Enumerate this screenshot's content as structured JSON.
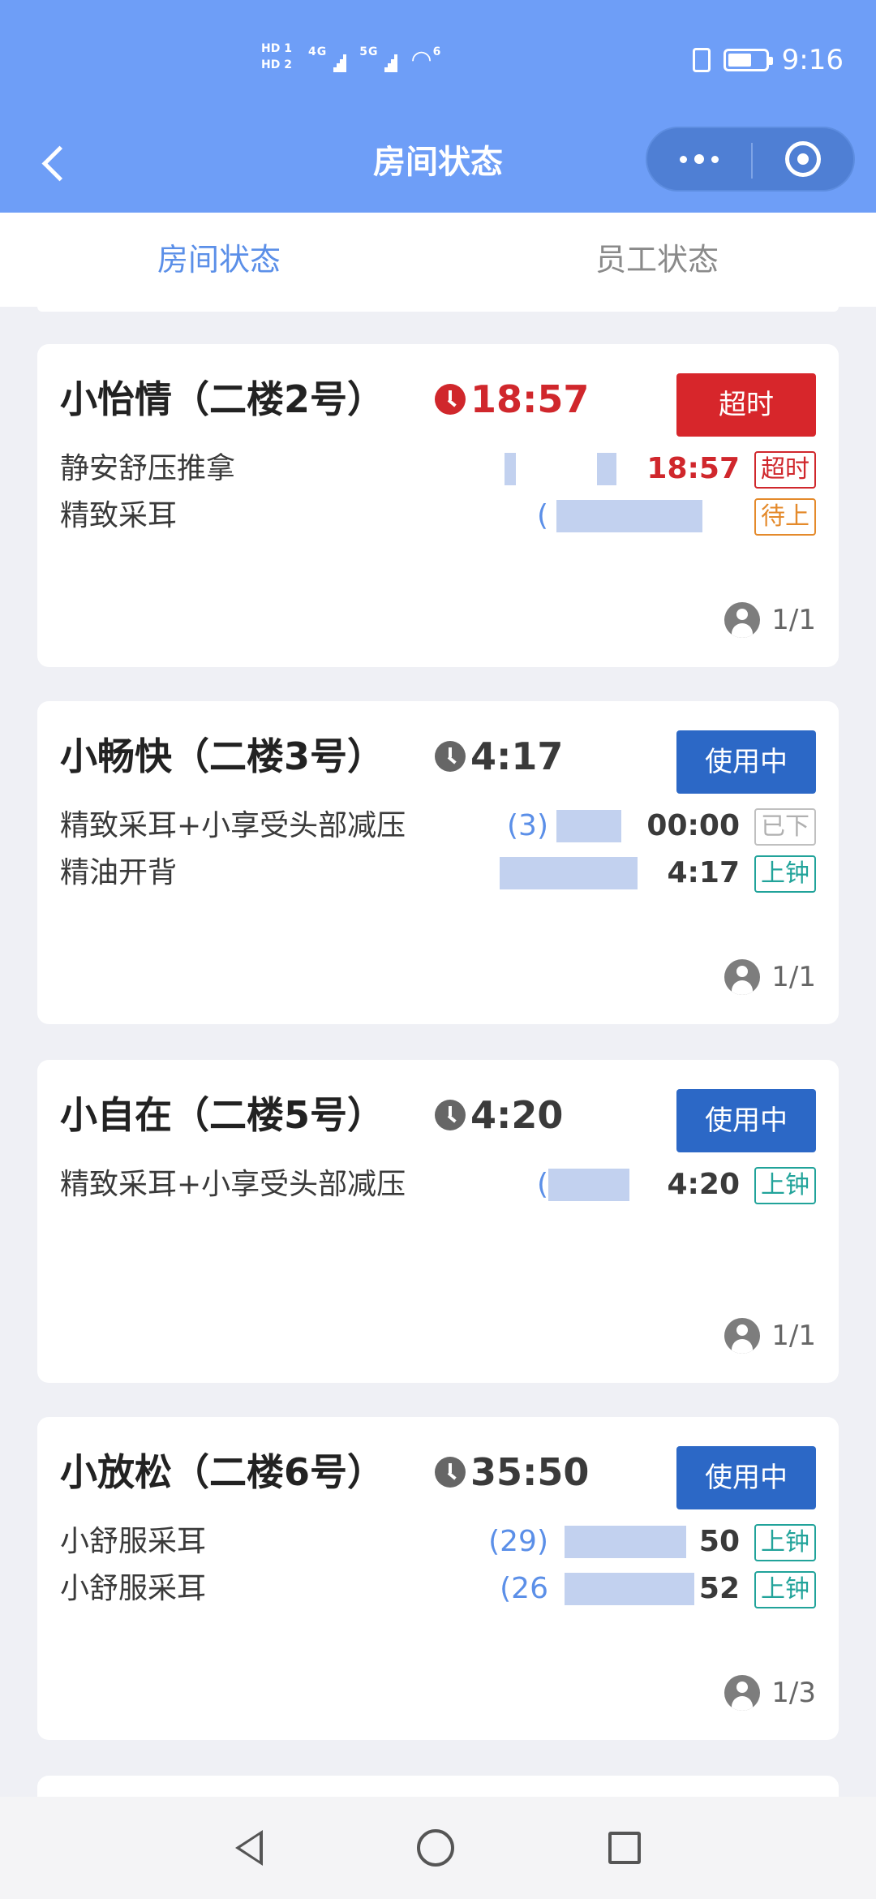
{
  "status_bar": {
    "sim1": "HD 1",
    "sim2": "HD 2",
    "net1": "4G",
    "net2": "5G",
    "wifi_label": "6",
    "time": "9:16"
  },
  "nav": {
    "title": "房间状态"
  },
  "tabs": [
    {
      "label": "房间状态",
      "active": true
    },
    {
      "label": "员工状态",
      "active": false
    }
  ],
  "rooms": [
    {
      "name": "小怡情（二楼2号）",
      "timer": "18:57",
      "timer_state": "overtime",
      "status": "超时",
      "services": [
        {
          "name": "静安舒压推拿",
          "staff": "",
          "time": "18:57",
          "badge": "超时"
        },
        {
          "name": "精致采耳",
          "staff": "(",
          "time": "",
          "badge": "待上"
        }
      ],
      "occupancy": "1/1"
    },
    {
      "name": "小畅快（二楼3号）",
      "timer": "4:17",
      "timer_state": "normal",
      "status": "使用中",
      "services": [
        {
          "name": "精致采耳+小享受头部减压",
          "staff": "(3)",
          "time": "00:00",
          "badge": "已下"
        },
        {
          "name": "精油开背",
          "staff": "",
          "time": "4:17",
          "badge": "上钟"
        }
      ],
      "occupancy": "1/1"
    },
    {
      "name": "小自在（二楼5号）",
      "timer": "4:20",
      "timer_state": "normal",
      "status": "使用中",
      "services": [
        {
          "name": "精致采耳+小享受头部减压",
          "staff": "(",
          "time": "4:20",
          "badge": "上钟"
        }
      ],
      "occupancy": "1/1"
    },
    {
      "name": "小放松（二楼6号）",
      "timer": "35:50",
      "timer_state": "normal",
      "status": "使用中",
      "services": [
        {
          "name": "小舒服采耳",
          "staff": "(29)",
          "time": "50",
          "badge": "上钟"
        },
        {
          "name": "小舒服采耳",
          "staff": "(26",
          "time": "52",
          "badge": "上钟"
        }
      ],
      "occupancy": "1/3"
    }
  ],
  "colors": {
    "header": "#6e9ef7",
    "overtime_red": "#d7262b",
    "in_use_blue": "#2c68c6",
    "tab_active": "#5b8fe8"
  }
}
